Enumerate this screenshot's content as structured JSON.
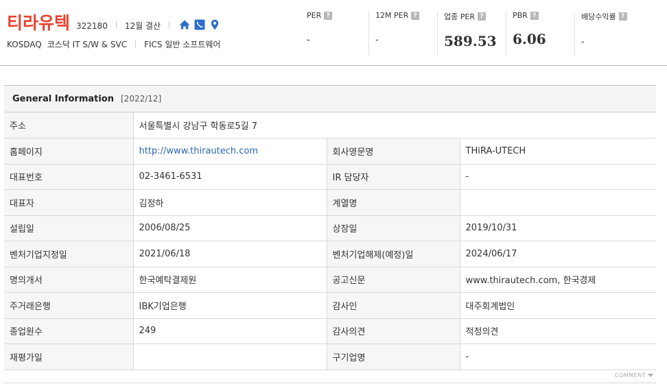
{
  "header": {
    "company_name": "티라유텍",
    "company_code": "322180",
    "fiscal": "12월 결산",
    "market": "KOSDAQ",
    "sector_kosdaq": "코스닥 IT S/W & SVC",
    "sector_fics": "FICS 일반 소프트웨어",
    "icons": [
      "home-icon",
      "phone-icon",
      "location-icon"
    ],
    "accent_color": "#e8422f",
    "icon_color": "#2f6ecb"
  },
  "metrics": [
    {
      "label": "PER",
      "value": "-"
    },
    {
      "label": "12M PER",
      "value": "-"
    },
    {
      "label": "업종 PER",
      "value": "589.53"
    },
    {
      "label": "PBR",
      "value": "6.06"
    },
    {
      "label": "배당수익률",
      "value": "-"
    }
  ],
  "info": {
    "title": "General Information",
    "year": "[2022/12]",
    "address_label": "주소",
    "address_value": "서울특별시 강남구 학동로5길 7",
    "rows": [
      {
        "k1": "홈페이지",
        "v1": "http://www.thirautech.com",
        "k2": "회사영문명",
        "v2": "THiRA-UTECH"
      },
      {
        "k1": "대표번호",
        "v1": "02-3461-6531",
        "k2": "IR 담당자",
        "v2": "-"
      },
      {
        "k1": "대표자",
        "v1": "김정하",
        "k2": "계열명",
        "v2": ""
      },
      {
        "k1": "설립일",
        "v1": "2006/08/25",
        "k2": "상장일",
        "v2": "2019/10/31"
      },
      {
        "k1": "벤처기업지정일",
        "v1": "2021/06/18",
        "k2": "벤처기업해제(예정)일",
        "v2": "2024/06/17"
      },
      {
        "k1": "명의개서",
        "v1": "한국예탁결제원",
        "k2": "공고신문",
        "v2": "www.thirautech.com, 한국경제"
      },
      {
        "k1": "주거래은행",
        "v1": "IBK기업은행",
        "k2": "감사인",
        "v2": "대주회계법인"
      },
      {
        "k1": "종업원수",
        "v1": "249",
        "k2": "감사의견",
        "v2": "적정의견"
      },
      {
        "k1": "재평가일",
        "v1": "",
        "k2": "구기업명",
        "v2": "-"
      }
    ]
  },
  "comment_label": "COMMENT"
}
